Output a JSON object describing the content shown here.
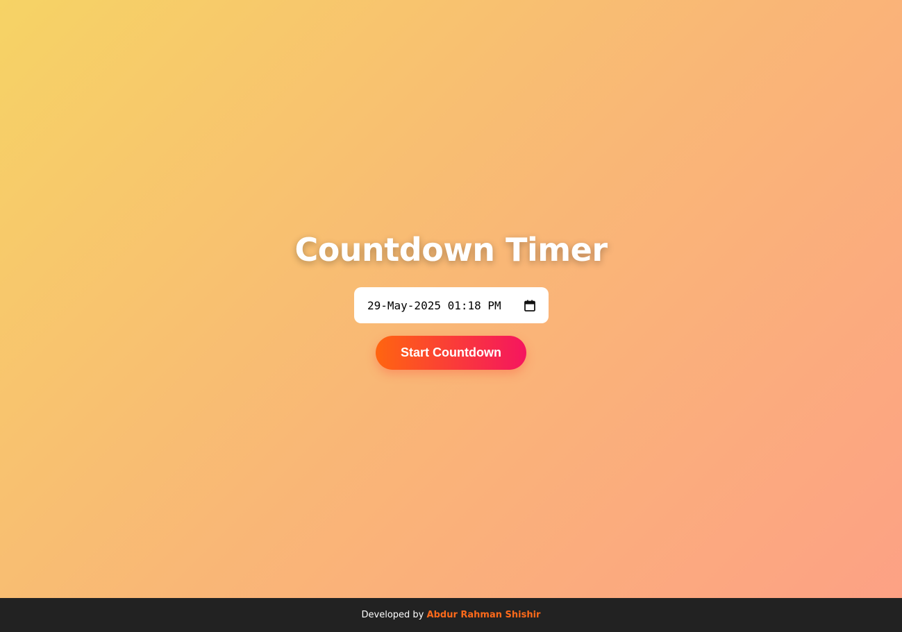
{
  "page": {
    "title": "Countdown Timer"
  },
  "datetime_input": {
    "value": "29-May-2025 01:18 PM",
    "icon": "calendar-icon"
  },
  "start_button": {
    "label": "Start Countdown"
  },
  "footer": {
    "prefix": "Developed by",
    "author": "Abdur Rahman Shishir"
  },
  "colors": {
    "background_start": "#f6d365",
    "background_end": "#fda085",
    "button_start": "#ff6510",
    "button_end": "#f5155f",
    "footer_bg": "#222222",
    "author_link": "#ff6a1a"
  }
}
